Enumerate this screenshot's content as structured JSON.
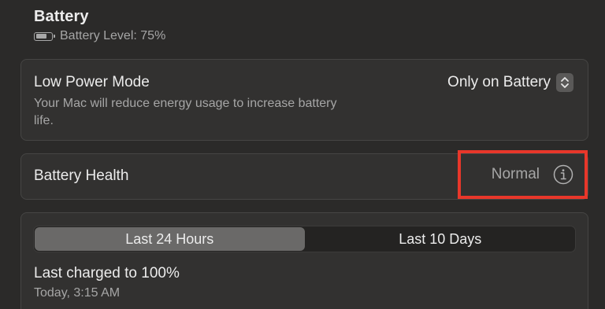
{
  "battery": {
    "title": "Battery",
    "level_text": "Battery Level: 75%",
    "level_fraction": 0.75
  },
  "low_power_mode": {
    "label": "Low Power Mode",
    "description": "Your Mac will reduce energy usage to increase battery life.",
    "selected_option": "Only on Battery"
  },
  "battery_health": {
    "label": "Battery Health",
    "status": "Normal",
    "info_icon": "info-circle-icon"
  },
  "usage": {
    "tabs": [
      {
        "label": "Last 24 Hours",
        "active": true
      },
      {
        "label": "Last 10 Days",
        "active": false
      }
    ],
    "last_charged": "Last charged to 100%",
    "last_charged_time": "Today, 3:15 AM"
  },
  "colors": {
    "background": "#2b2a29",
    "card": "#323130",
    "highlight": "#e8372a"
  }
}
